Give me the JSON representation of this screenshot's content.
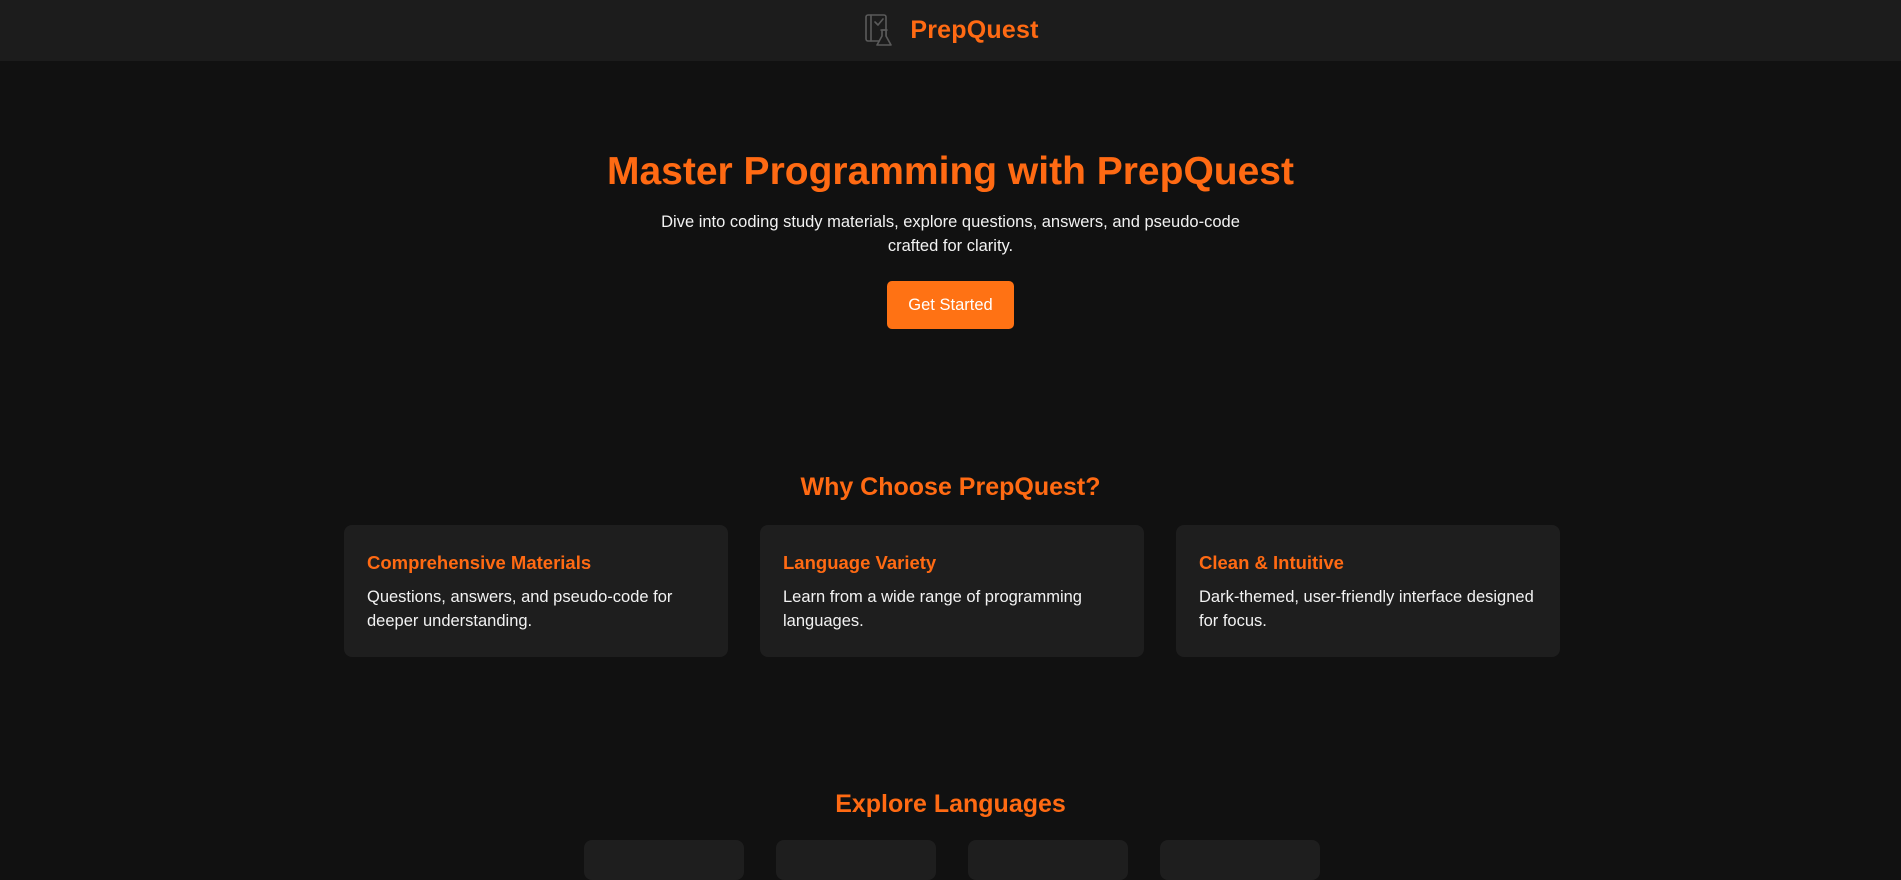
{
  "nav": {
    "brand": "PrepQuest",
    "logo_icon": "notebook-flask-icon"
  },
  "hero": {
    "title": "Master Programming with PrepQuest",
    "subtitle": "Dive into coding study materials, explore questions, answers, and pseudo-code crafted for clarity.",
    "cta_label": "Get Started"
  },
  "features": {
    "title": "Why Choose PrepQuest?",
    "cards": [
      {
        "title": "Comprehensive Materials",
        "description": "Questions, answers, and pseudo-code for deeper understanding."
      },
      {
        "title": "Language Variety",
        "description": "Learn from a wide range of programming languages."
      },
      {
        "title": "Clean & Intuitive",
        "description": "Dark-themed, user-friendly interface designed for focus."
      }
    ]
  },
  "explore": {
    "title": "Explore Languages"
  },
  "colors": {
    "accent": "#ff6a13",
    "background": "#111111",
    "navbar": "#1c1c1c",
    "card": "#1e1e1e"
  }
}
